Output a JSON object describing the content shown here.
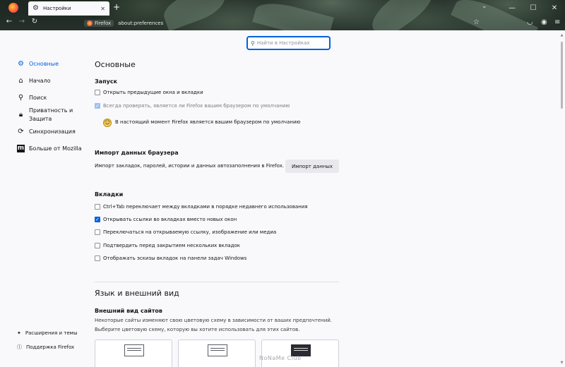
{
  "tab": {
    "title": "Настройки"
  },
  "urlbar": {
    "identity": "Firefox",
    "url": "about:preferences"
  },
  "search": {
    "placeholder": "Найти в Настройках"
  },
  "sidebar": {
    "items": [
      {
        "label": "Основные",
        "icon": "gear-icon",
        "active": true
      },
      {
        "label": "Начало",
        "icon": "home-icon"
      },
      {
        "label": "Поиск",
        "icon": "search-icon"
      },
      {
        "label": "Приватность и Защита",
        "icon": "lock-icon"
      },
      {
        "label": "Синхронизация",
        "icon": "sync-icon"
      },
      {
        "label": "Больше от Mozilla",
        "icon": "mozilla-icon"
      }
    ],
    "footer": [
      {
        "label": "Расширения и темы",
        "icon": "puzzle-icon"
      },
      {
        "label": "Поддержка Firefox",
        "icon": "help-icon"
      }
    ]
  },
  "main": {
    "title": "Основные",
    "startup": {
      "heading": "Запуск",
      "restore": "Открыть предыдущие окна и вкладки",
      "check_default": "Всегда проверять, является ли Firefox вашим браузером по умолчанию",
      "default_msg": "В настоящий момент Firefox является вашим браузером по умолчанию"
    },
    "import": {
      "heading": "Импорт данных браузера",
      "desc": "Импорт закладок, паролей, истории и данных автозаполнения в Firefox.",
      "button": "Импорт данных"
    },
    "tabs": {
      "heading": "Вкладки",
      "opt1": "Ctrl+Tab переключает между вкладками в порядке недавнего использования",
      "opt2": "Открывать ссылки во вкладках вместо новых окон",
      "opt3": "Переключаться на открываемую ссылку, изображение или медиа",
      "opt4": "Подтвердить перед закрытием нескольких вкладок",
      "opt5": "Отображать эскизы вкладок на панели задач Windows"
    },
    "language": {
      "title": "Язык и внешний вид",
      "appearance_heading": "Внешний вид сайтов",
      "desc1": "Некоторые сайты изменяют свою цветовую схему в зависимости от ваших предпочтений.",
      "desc2": "Выберите цветовую схему, которую вы хотите использовать для этих сайтов."
    }
  },
  "watermark": "NoNaMe Club",
  "colors": {
    "accent": "#0061e0",
    "page_bg": "#f9f9fb",
    "text": "#15141a"
  }
}
